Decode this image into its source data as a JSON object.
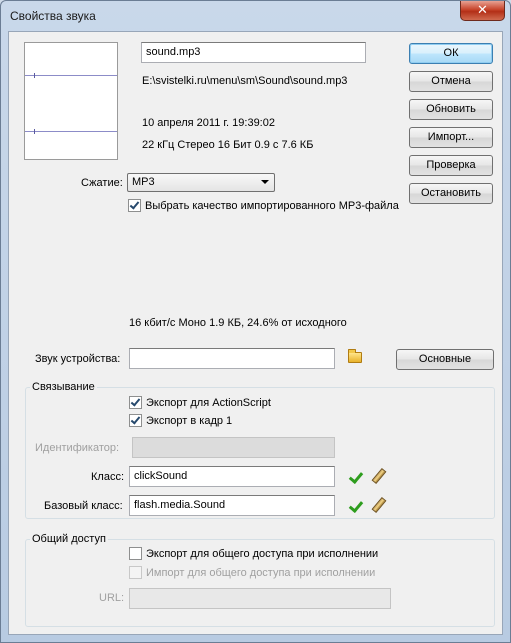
{
  "window": {
    "title": "Свойства звука",
    "close_label": "✕"
  },
  "sound": {
    "name_value": "sound.mp3",
    "path": "E:\\svistelki.ru\\menu\\sm\\Sound\\sound.mp3",
    "datetime": "10 апреля 2011 г.   19:39:02",
    "format": "22 кГц Стерео 16 Бит 0.9 с 7.6 КБ"
  },
  "buttons": {
    "ok": "ОК",
    "cancel": "Отмена",
    "update": "Обновить",
    "import": "Импорт...",
    "test": "Проверка",
    "stop": "Остановить",
    "basic": "Основные"
  },
  "compression": {
    "label": "Сжатие:",
    "selected": "MP3",
    "use_imported_quality": true,
    "use_imported_quality_label": "Выбрать качество импортированного MP3-файла",
    "summary": "16 кбит/с  Моно 1.9 КБ, 24.6% от исходного"
  },
  "device_sound": {
    "label": "Звук устройства:",
    "value": ""
  },
  "linkage": {
    "title": "Связывание",
    "export_actionscript": true,
    "export_actionscript_label": "Экспорт для ActionScript",
    "export_first_frame": true,
    "export_first_frame_label": "Экспорт в кадр 1",
    "identifier_label": "Идентификатор:",
    "identifier_value": "",
    "class_label": "Класс:",
    "class_value": "clickSound",
    "base_class_label": "Базовый класс:",
    "base_class_value": "flash.media.Sound"
  },
  "sharing": {
    "title": "Общий доступ",
    "export_runtime": false,
    "export_runtime_label": "Экспорт для общего доступа при исполнении",
    "import_runtime": false,
    "import_runtime_label": "Импорт для общего доступа при исполнении",
    "url_label": "URL:",
    "url_value": ""
  },
  "colors": {
    "accent": "#3c7fb1",
    "check_green": "#2e9d1e"
  }
}
